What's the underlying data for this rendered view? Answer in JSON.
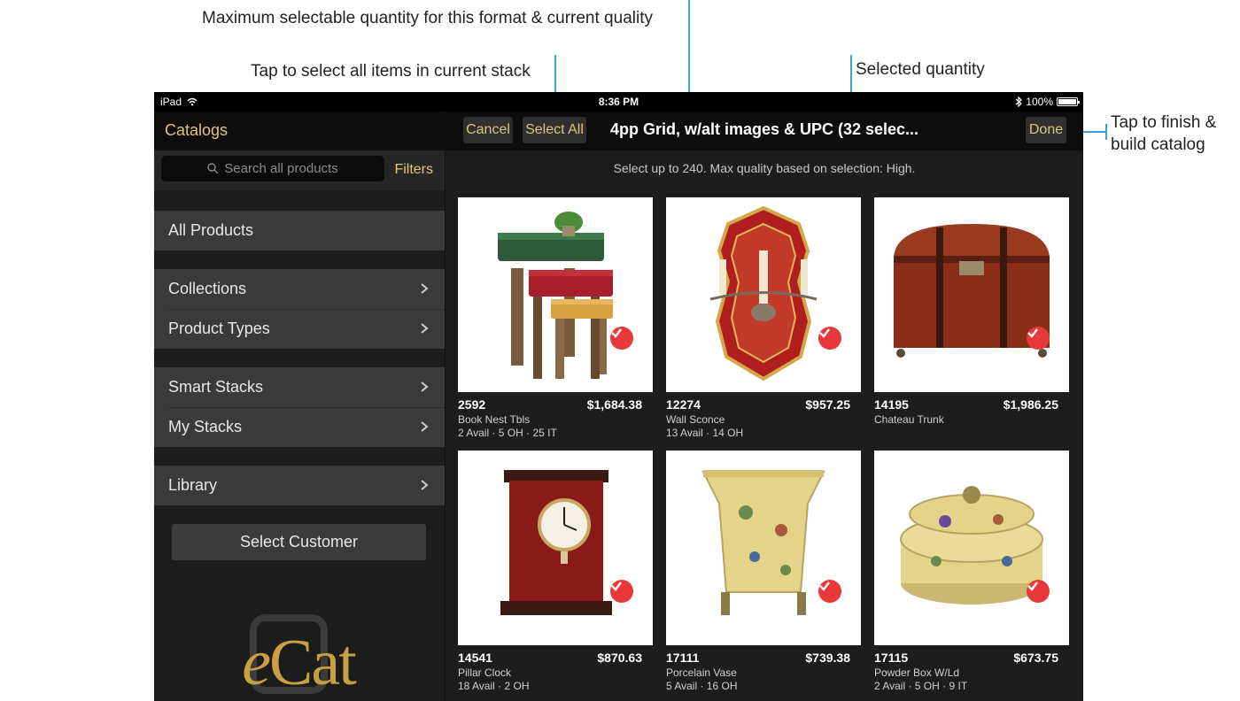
{
  "callouts": {
    "max_quantity": "Maximum selectable quantity for this format & current quality",
    "select_all": "Tap to select all items in current stack",
    "selected_quantity": "Selected quantity",
    "finish_line1": "Tap to finish &",
    "finish_line2": "build catalog"
  },
  "status_bar": {
    "device": "iPad",
    "time": "8:36 PM",
    "battery": "100%"
  },
  "left_panel": {
    "title": "Catalogs",
    "search_placeholder": "Search all products",
    "filters_label": "Filters",
    "all_products": "All Products",
    "collections": "Collections",
    "product_types": "Product Types",
    "smart_stacks": "Smart Stacks",
    "my_stacks": "My Stacks",
    "library": "Library",
    "select_customer": "Select Customer",
    "logo_text": "eCat"
  },
  "right_panel": {
    "cancel": "Cancel",
    "select_all": "Select All",
    "title": "4pp Grid, w/alt images & UPC (32 selec...",
    "done": "Done",
    "info": "Select up to 240. Max quality based on selection: High."
  },
  "products": [
    {
      "sku": "2592",
      "price": "$1,684.38",
      "name": "Book Nest Tbls",
      "stock": "2 Avail · 5 OH · 25 IT",
      "selected": true,
      "image": "nesting-tables"
    },
    {
      "sku": "12274",
      "price": "$957.25",
      "name": "Wall Sconce",
      "stock": "13 Avail · 14 OH",
      "selected": true,
      "image": "wall-sconce"
    },
    {
      "sku": "14195",
      "price": "$1,986.25",
      "name": "Chateau Trunk",
      "stock": "",
      "selected": true,
      "image": "trunk"
    },
    {
      "sku": "14541",
      "price": "$870.63",
      "name": "Pillar Clock",
      "stock": "18 Avail · 2 OH",
      "selected": true,
      "image": "clock"
    },
    {
      "sku": "17111",
      "price": "$739.38",
      "name": "Porcelain Vase",
      "stock": "5 Avail · 16 OH",
      "selected": true,
      "image": "vase"
    },
    {
      "sku": "17115",
      "price": "$673.75",
      "name": "Powder Box W/Ld",
      "stock": "2 Avail · 5 OH · 9 IT",
      "selected": true,
      "image": "powder-box"
    }
  ],
  "colors": {
    "accent": "#e2c37a",
    "callout_line": "#3aa6c9",
    "check": "#e8383a"
  }
}
